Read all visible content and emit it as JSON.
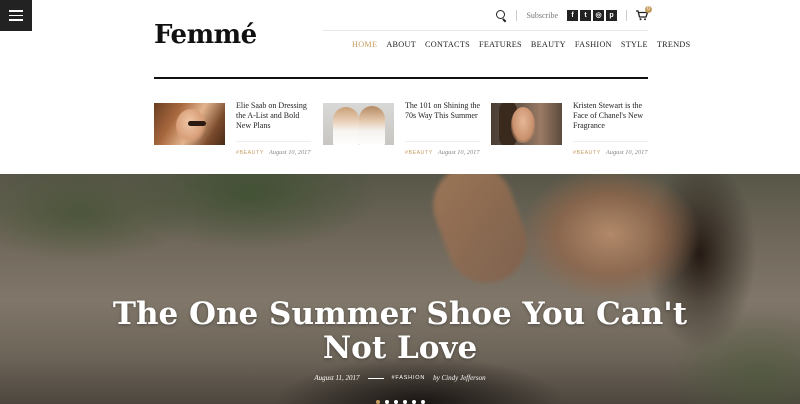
{
  "brand": {
    "logo": "Femmé",
    "accent": "#c59d5f"
  },
  "utility": {
    "subscribe_label": "Subscribe",
    "socials": [
      {
        "icon": "facebook-icon",
        "glyph": "f"
      },
      {
        "icon": "twitter-icon",
        "glyph": "t"
      },
      {
        "icon": "instagram-icon",
        "glyph": "◎"
      },
      {
        "icon": "pinterest-icon",
        "glyph": "p"
      }
    ],
    "cart_count": "0"
  },
  "nav": {
    "items": [
      "HOME",
      "ABOUT",
      "CONTACTS",
      "FEATURES",
      "BEAUTY",
      "FASHION",
      "STYLE",
      "TRENDS"
    ],
    "active": "HOME"
  },
  "featured": [
    {
      "title": "Elie Saab on Dressing the A-List and Bold New Plans",
      "tag": "#BEAUTY",
      "date": "August 10, 2017"
    },
    {
      "title": "The 101 on Shining the 70s Way This Summer",
      "tag": "#BEAUTY",
      "date": "August 10, 2017"
    },
    {
      "title": "Kristen Stewart is the Face of Chanel's New Fragrance",
      "tag": "#BEAUTY",
      "date": "August 10, 2017"
    }
  ],
  "hero": {
    "title_line1": "The One Summer Shoe You Can't",
    "title_line2": "Not Love",
    "date": "August 11, 2017",
    "tag": "#FASHION",
    "byline": "by Cindy Jefferson",
    "slide_count": 6,
    "active_slide": 1
  }
}
